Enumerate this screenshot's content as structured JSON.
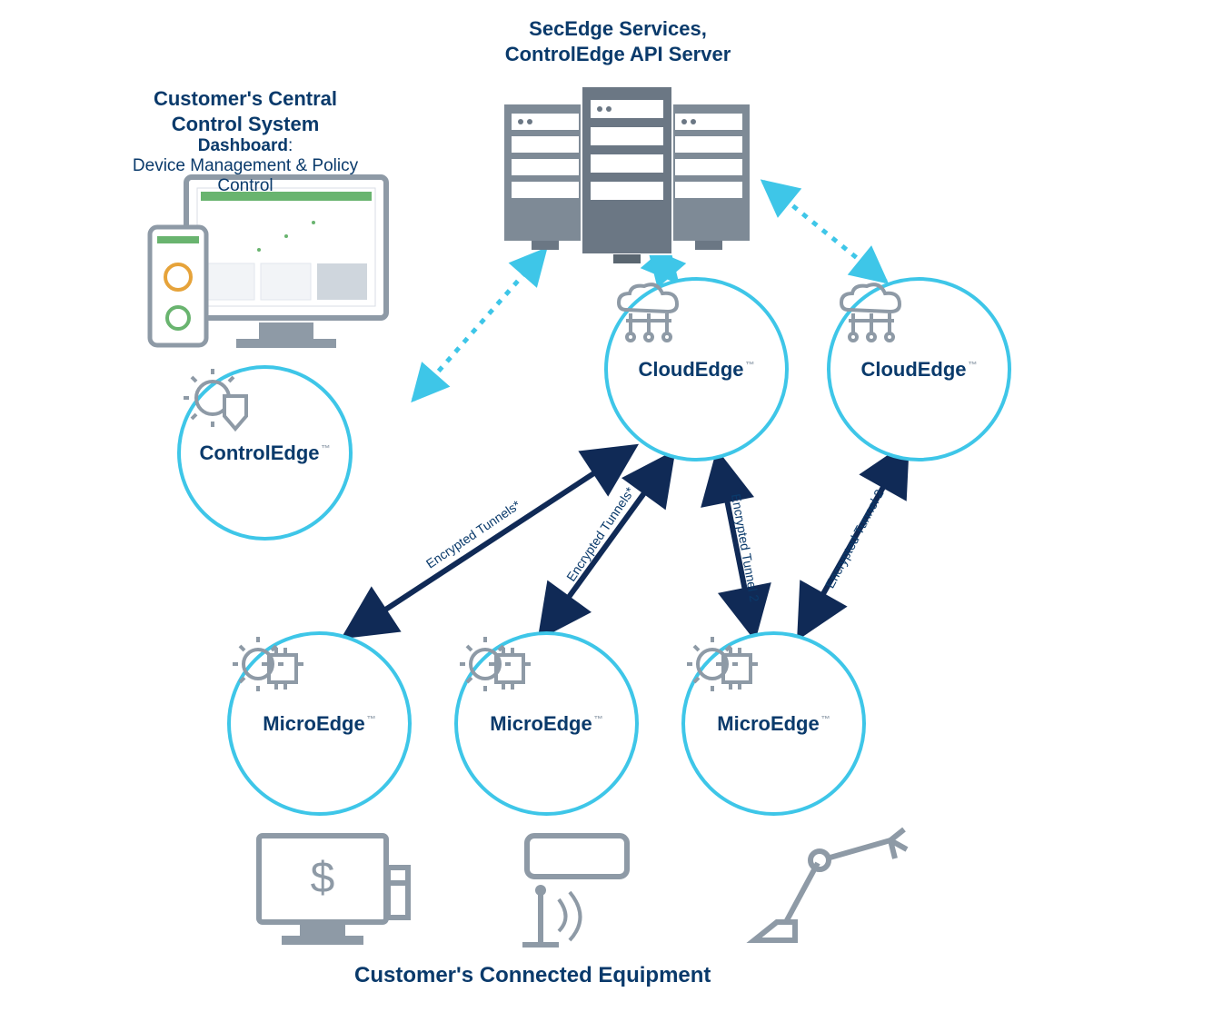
{
  "titles": {
    "server": "SecEdge Services,\nControlEdge API Server",
    "customer_system_line1": "Customer's Central",
    "customer_system_line2": "Control System",
    "dashboard_bold": "Dashboard",
    "dashboard_rest": ":",
    "dashboard_sub": "Device Management & Policy Control",
    "bottom": "Customer's Connected Equipment"
  },
  "nodes": {
    "controledge": "ControlEdge",
    "cloudedge1": "CloudEdge",
    "cloudedge2": "CloudEdge",
    "microedge1": "MicroEdge",
    "microedge2": "MicroEdge",
    "microedge3": "MicroEdge",
    "tm": "™"
  },
  "edges": {
    "tunnel_a": "Encrypted Tunnels*",
    "tunnel_b": "Encrypted Tunnels*",
    "tunnel_c": "Encrypted Tunnel 2",
    "tunnel_d": "Encrypted Tunnel 2"
  },
  "icons": {
    "servers": "server-rack-icon",
    "monitor_phone": "dashboard-monitor-phone-icon",
    "gear_shield": "gear-shield-icon",
    "cloud_net": "cloud-network-icon",
    "gear_chip": "gear-chip-icon",
    "pos": "pos-terminal-icon",
    "camera": "security-camera-icon",
    "robot": "robot-arm-icon"
  },
  "colors": {
    "brand_navy": "#0a3a6b",
    "cyan": "#3ec6e8",
    "gray": "#8e9aa6",
    "dark_navy": "#102a56"
  }
}
